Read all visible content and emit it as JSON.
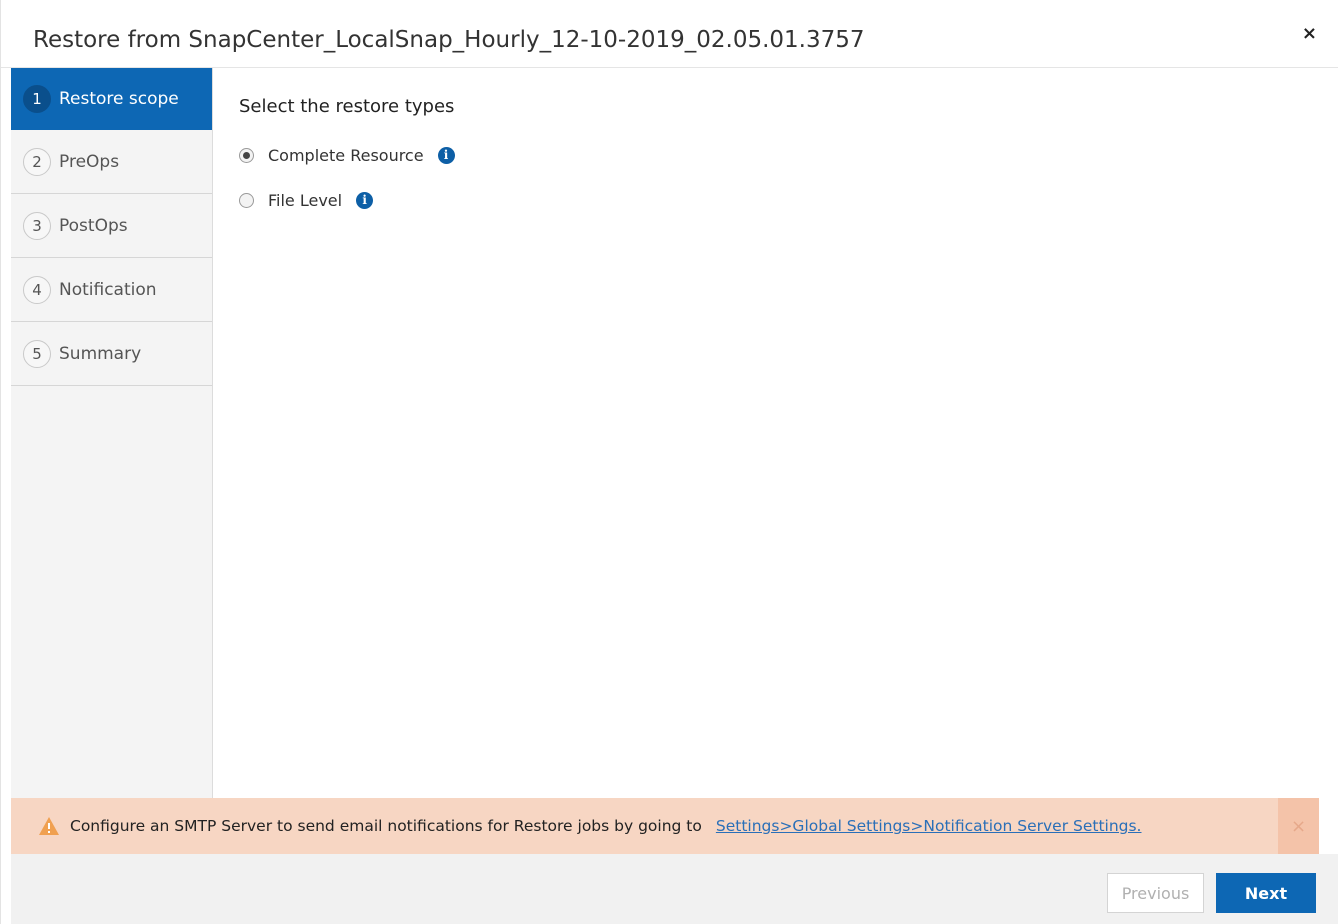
{
  "dialog": {
    "title": "Restore from SnapCenter_LocalSnap_Hourly_12-10-2019_02.05.01.3757",
    "close_label": "×"
  },
  "steps": [
    {
      "num": "1",
      "label": "Restore scope",
      "active": true
    },
    {
      "num": "2",
      "label": "PreOps",
      "active": false
    },
    {
      "num": "3",
      "label": "PostOps",
      "active": false
    },
    {
      "num": "4",
      "label": "Notification",
      "active": false
    },
    {
      "num": "5",
      "label": "Summary",
      "active": false
    }
  ],
  "content": {
    "section_title": "Select the restore types",
    "options": [
      {
        "label": "Complete Resource",
        "selected": true,
        "info_glyph": "i"
      },
      {
        "label": "File Level",
        "selected": false,
        "info_glyph": "i"
      }
    ]
  },
  "warning": {
    "text": "Configure an SMTP Server to send email notifications for Restore jobs by going to",
    "link": "Settings>Global Settings>Notification Server Settings.",
    "close_label": "×"
  },
  "footer": {
    "previous_label": "Previous",
    "next_label": "Next"
  },
  "colors": {
    "accent": "#0d67b4",
    "warning_bg": "#f7d6c3",
    "warning_icon": "#f0a050"
  },
  "icons": {
    "close": "close-icon",
    "info": "info-icon",
    "warning": "warning-icon"
  }
}
